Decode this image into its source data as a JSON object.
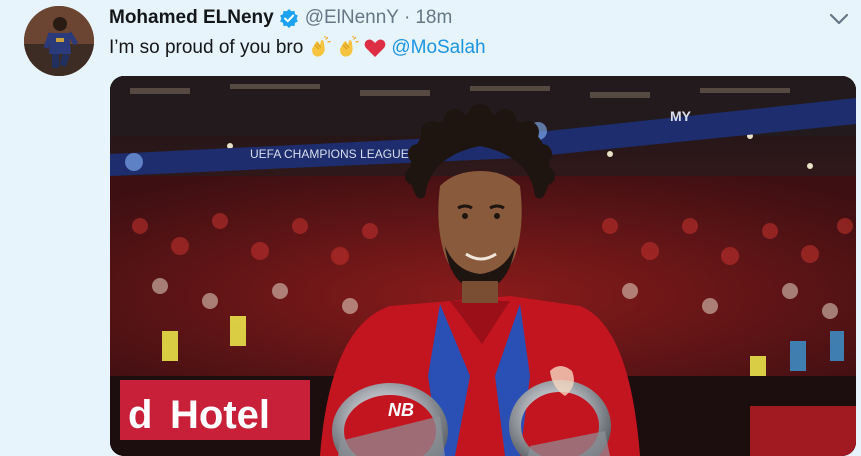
{
  "tweet": {
    "author_name": "Mohamed ELNeny",
    "handle": "@ElNennY",
    "separator": "·",
    "time": "18m",
    "text": "I’m so proud of you bro",
    "emojis": [
      "clapping-hands",
      "clapping-hands",
      "red-heart"
    ],
    "mention": "@MoSalah",
    "verified": true
  },
  "media": {
    "stadium_banner": "UEFA CHAMPIONS LEAGUE",
    "board_text": "Hotel",
    "board_fragment": "d",
    "top_sign": "MY",
    "sponsor_mark": "NB"
  },
  "colors": {
    "background": "#e8f4fc",
    "link": "#1b95e0",
    "verified": "#1da1f2",
    "muted": "#657786",
    "text": "#14171a"
  }
}
